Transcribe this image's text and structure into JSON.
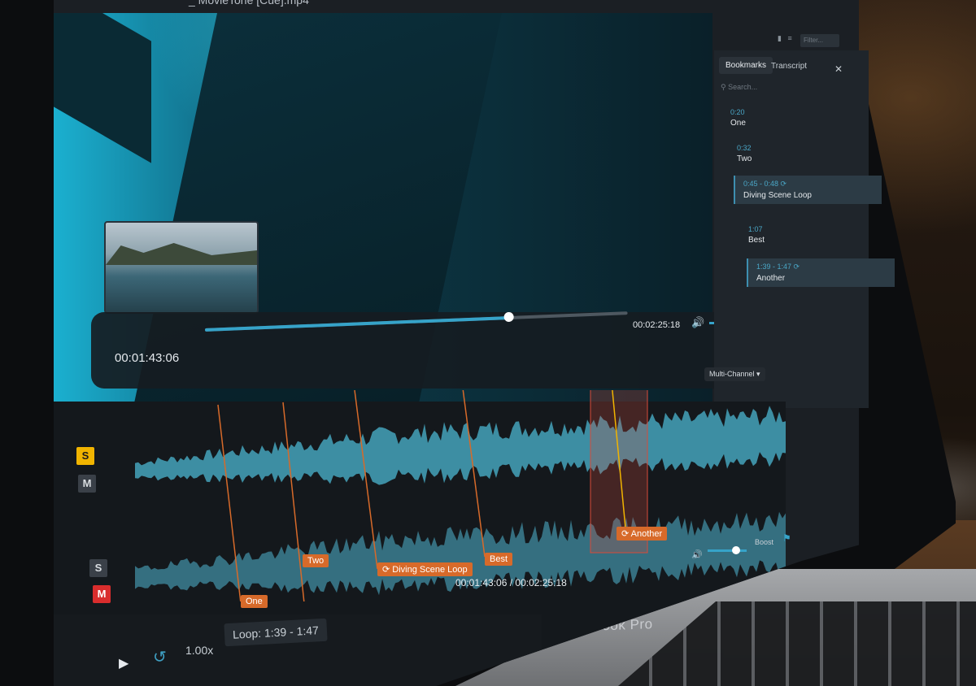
{
  "window": {
    "title": "_ MovieTone [Cue].mp4"
  },
  "player": {
    "current_time": "00:01:43:06",
    "total_time": "00:02:25:18",
    "progress": 0.72,
    "volume": 0.65
  },
  "panel": {
    "tabs": [
      "Bookmarks",
      "Transcript"
    ],
    "search_placeholder": "Search...",
    "filter_placeholder": "Filter...",
    "bookmarks": [
      {
        "time": "0:20",
        "label": "One",
        "loop": false
      },
      {
        "time": "0:32",
        "label": "Two",
        "loop": false
      },
      {
        "time": "0:45 - 0:48",
        "label": "Diving Scene Loop",
        "loop": true
      },
      {
        "time": "1:07",
        "label": "Best",
        "loop": false
      },
      {
        "time": "1:39 - 1:47",
        "label": "Another",
        "loop": true
      }
    ]
  },
  "waveform": {
    "channel_mode": "Multi-Channel",
    "markers": [
      "One",
      "Two",
      "Diving Scene Loop",
      "Best",
      "Another"
    ],
    "time_readout": "00:01:43:06 / 00:02:25:18",
    "boost_label": "Boost",
    "tracks": [
      {
        "solo": "S",
        "mute": "M",
        "solo_active": true,
        "mute_active": false
      },
      {
        "solo": "S",
        "mute": "M",
        "solo_active": false,
        "mute_active": true
      }
    ]
  },
  "transport": {
    "speed": "1.00x",
    "loop": "Loop: 1:39 - 1:47"
  },
  "device": {
    "brand": "MacBook Pro"
  },
  "colors": {
    "accent": "#36a3c9",
    "marker": "#d76a2a",
    "solo": "#f1b400",
    "mute": "#d92d2d"
  }
}
